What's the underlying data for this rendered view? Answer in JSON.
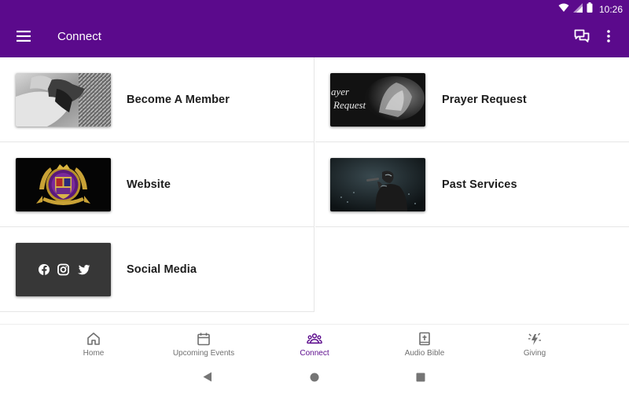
{
  "status_bar": {
    "time": "10:26"
  },
  "app_bar": {
    "title": "Connect"
  },
  "tiles": [
    {
      "label": "Become A Member"
    },
    {
      "label": "Prayer Request",
      "thumb_text_1": "ayer",
      "thumb_text_2": "Request"
    },
    {
      "label": "Website"
    },
    {
      "label": "Past Services"
    },
    {
      "label": "Social Media"
    }
  ],
  "bottom_nav": {
    "items": [
      {
        "label": "Home",
        "icon": "home-icon"
      },
      {
        "label": "Upcoming Events",
        "icon": "calendar-icon"
      },
      {
        "label": "Connect",
        "icon": "people-icon",
        "active": true
      },
      {
        "label": "Audio Bible",
        "icon": "bible-icon"
      },
      {
        "label": "Giving",
        "icon": "giving-icon"
      }
    ]
  },
  "colors": {
    "primary": "#5b0a8c",
    "text": "#1d1d1d",
    "nav_inactive": "#707070"
  }
}
